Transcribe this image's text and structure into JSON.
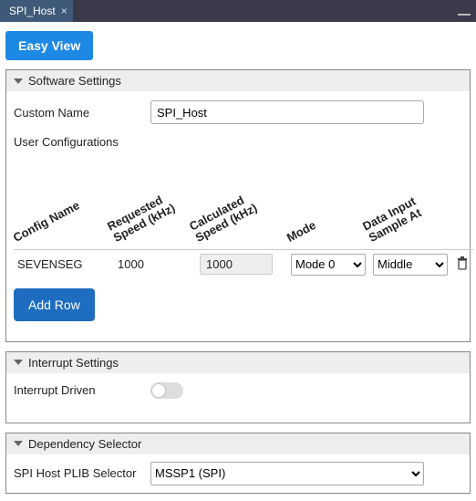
{
  "tab": {
    "title": "SPI_Host"
  },
  "easy_view_label": "Easy View",
  "sections": {
    "software": {
      "title": "Software Settings",
      "custom_name_label": "Custom Name",
      "custom_name_value": "SPI_Host",
      "user_conf_label": "User Configurations",
      "headers": {
        "config_name": "Config Name",
        "req_speed_l1": "Requested",
        "req_speed_l2": "Speed (kHz)",
        "calc_speed_l1": "Calculated",
        "calc_speed_l2": "Speed (kHz)",
        "mode": "Mode",
        "sample_l1": "Data Input",
        "sample_l2": "Sample At"
      },
      "rows": [
        {
          "name": "SEVENSEG",
          "req": "1000",
          "calc": "1000",
          "mode": "Mode 0",
          "sample": "Middle"
        }
      ],
      "add_row_label": "Add Row"
    },
    "interrupt": {
      "title": "Interrupt Settings",
      "driven_label": "Interrupt Driven",
      "driven_value": false
    },
    "dependency": {
      "title": "Dependency Selector",
      "plib_label": "SPI Host PLIB Selector",
      "plib_value": "MSSP1 (SPI)"
    }
  }
}
